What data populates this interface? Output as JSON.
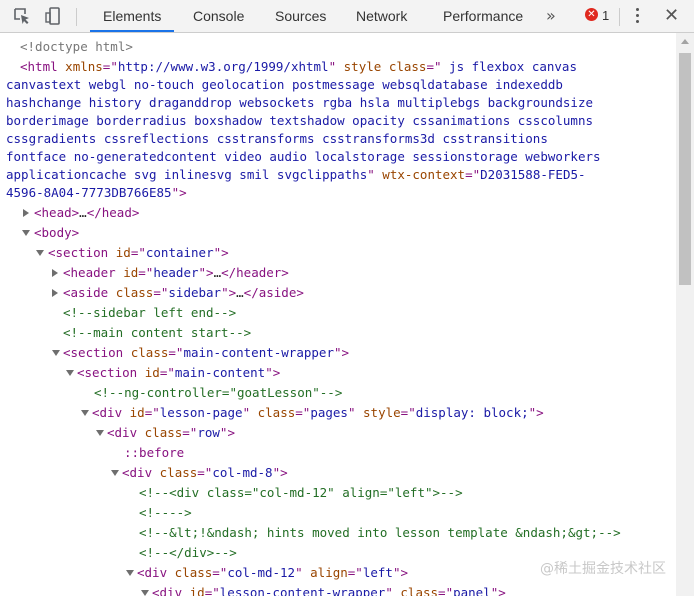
{
  "toolbar": {
    "tabs": [
      {
        "label": "Elements",
        "active": true
      },
      {
        "label": "Console",
        "active": false
      },
      {
        "label": "Sources",
        "active": false
      },
      {
        "label": "Network",
        "active": false
      },
      {
        "label": "Performance",
        "active": false
      }
    ],
    "more_label": "»",
    "error_icon_glyph": "✕",
    "error_count": "1",
    "accent_color": "#1a73e8",
    "error_color": "#e0291f"
  },
  "dom": {
    "doctype": "<!doctype html>",
    "html_open": [
      "<html",
      " xmlns",
      "=\"",
      "http://www.w3.org/1999/xhtml",
      "\" ",
      "style",
      " ",
      "class",
      "=\"",
      " js flexbox canvas"
    ],
    "html_wrap": [
      "canvastext webgl no-touch geolocation postmessage websqldatabase indexeddb",
      "hashchange history draganddrop websockets rgba hsla multiplebgs backgroundsize",
      "borderimage borderradius boxshadow textshadow opacity cssanimations csscolumns",
      "cssgradients cssreflections csstransforms csstransforms3d csstransitions",
      "fontface no-generatedcontent video audio localstorage sessionstorage webworkers"
    ],
    "html_last_text": "applicationcache svg inlinesvg smil svgclippaths",
    "html_wtx_attr": "wtx-context",
    "html_wtx_val_1": "D2031588-FED5-",
    "html_wtx_val_2": "4596-8A04-7773DB766E85",
    "head": {
      "open": "<head>",
      "ellipsis": "…",
      "close": "</head>"
    },
    "body_open": "<body>",
    "section": {
      "tag": "<section",
      "attr": "id",
      "val": "container"
    },
    "header": {
      "tag": "<header",
      "attr": "id",
      "val": "header",
      "ellipsis": "…",
      "close": "</header>"
    },
    "aside": {
      "tag": "<aside",
      "attr": "class",
      "val": "sidebar",
      "ellipsis": "…",
      "close": "</aside>"
    },
    "comment_sidebar_end": "<!--sidebar left end-->",
    "comment_main_start": "<!--main content start-->",
    "section_wrapper": {
      "tag": "<section",
      "attr": "class",
      "val": "main-content-wrapper"
    },
    "section_main": {
      "tag": "<section",
      "attr": "id",
      "val": "main-content"
    },
    "comment_ng": "<!--ng-controller=\"goatLesson\"-->",
    "div_lesson_page": {
      "tag": "<div",
      "attr1": "id",
      "val1": "lesson-page",
      "attr2": "class",
      "val2": "pages",
      "attr3": "style",
      "val3": "display: block;"
    },
    "div_row": {
      "tag": "<div",
      "attr": "class",
      "val": "row"
    },
    "before": "::before",
    "div_col8": {
      "tag": "<div",
      "attr": "class",
      "val": "col-md-8"
    },
    "comment_div12": "<!--<div class=\"col-md-12\" align=\"left\">-->",
    "comment_dashes": "<!---->",
    "comment_hints": "<!--&lt;!&ndash; hints moved into lesson template &ndash;&gt;-->",
    "comment_div_close": "<!--</div>-->",
    "div_col12": {
      "tag": "<div",
      "attr1": "class",
      "val1": "col-md-12",
      "attr2": "align",
      "val2": "left"
    },
    "div_lesson_content": {
      "tag": "<div",
      "attr1": "id",
      "val1": "lesson-content-wrapper",
      "attr2": "class",
      "val2": "panel"
    }
  },
  "watermark": "@稀土掘金技术社区"
}
